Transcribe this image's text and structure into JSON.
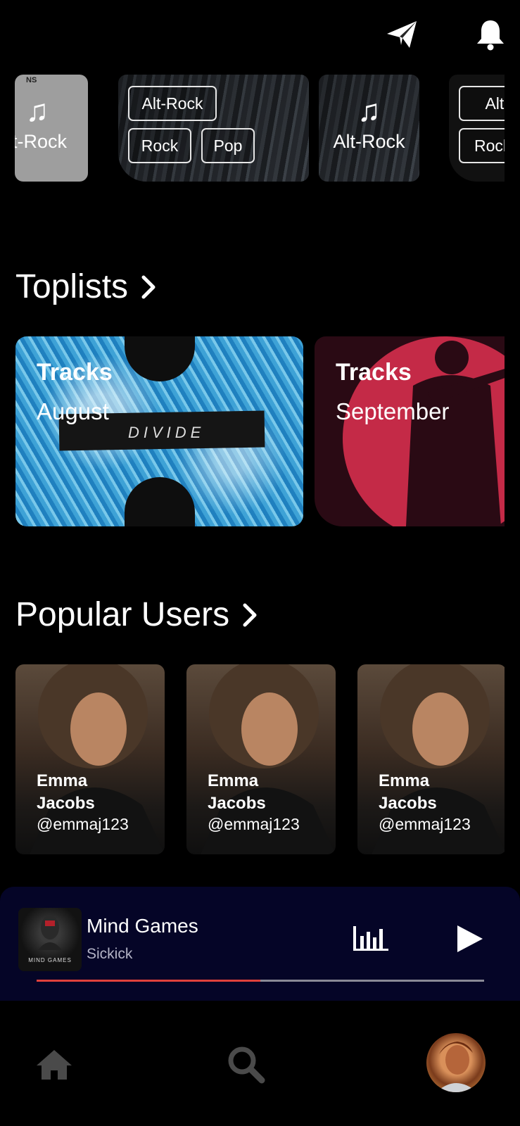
{
  "header": {
    "send_icon": "paper-plane-icon",
    "notifications_icon": "bell-icon"
  },
  "genres": {
    "card1": {
      "label": "lt-Rock",
      "icon": "music-note-icon",
      "partial_text": "NS"
    },
    "card2": {
      "pills": [
        "Alt-Rock",
        "Rock",
        "Pop"
      ]
    },
    "card3": {
      "label": "Alt-Rock",
      "icon": "music-note-icon"
    },
    "card4": {
      "pills": [
        "Alt-R",
        "Rocl"
      ]
    }
  },
  "toplists": {
    "title": "Toplists",
    "items": [
      {
        "label": "Tracks",
        "month": "August",
        "cover_text": "DIVIDE"
      },
      {
        "label": "Tracks",
        "month": "September"
      }
    ]
  },
  "popular_users": {
    "title": "Popular Users",
    "items": [
      {
        "first": "Emma",
        "last": "Jacobs",
        "handle": "@emmaj123"
      },
      {
        "first": "Emma",
        "last": "Jacobs",
        "handle": "@emmaj123"
      },
      {
        "first": "Emma",
        "last": "Jacobs",
        "handle": "@emmaj123"
      }
    ]
  },
  "now_playing": {
    "title": "Mind Games",
    "artist": "Sickick",
    "album_text": "MIND GAMES",
    "progress": 0.5,
    "accent_color": "#e0413b"
  },
  "bottom_nav": {
    "home_icon": "home-icon",
    "search_icon": "search-icon",
    "profile": "avatar"
  }
}
